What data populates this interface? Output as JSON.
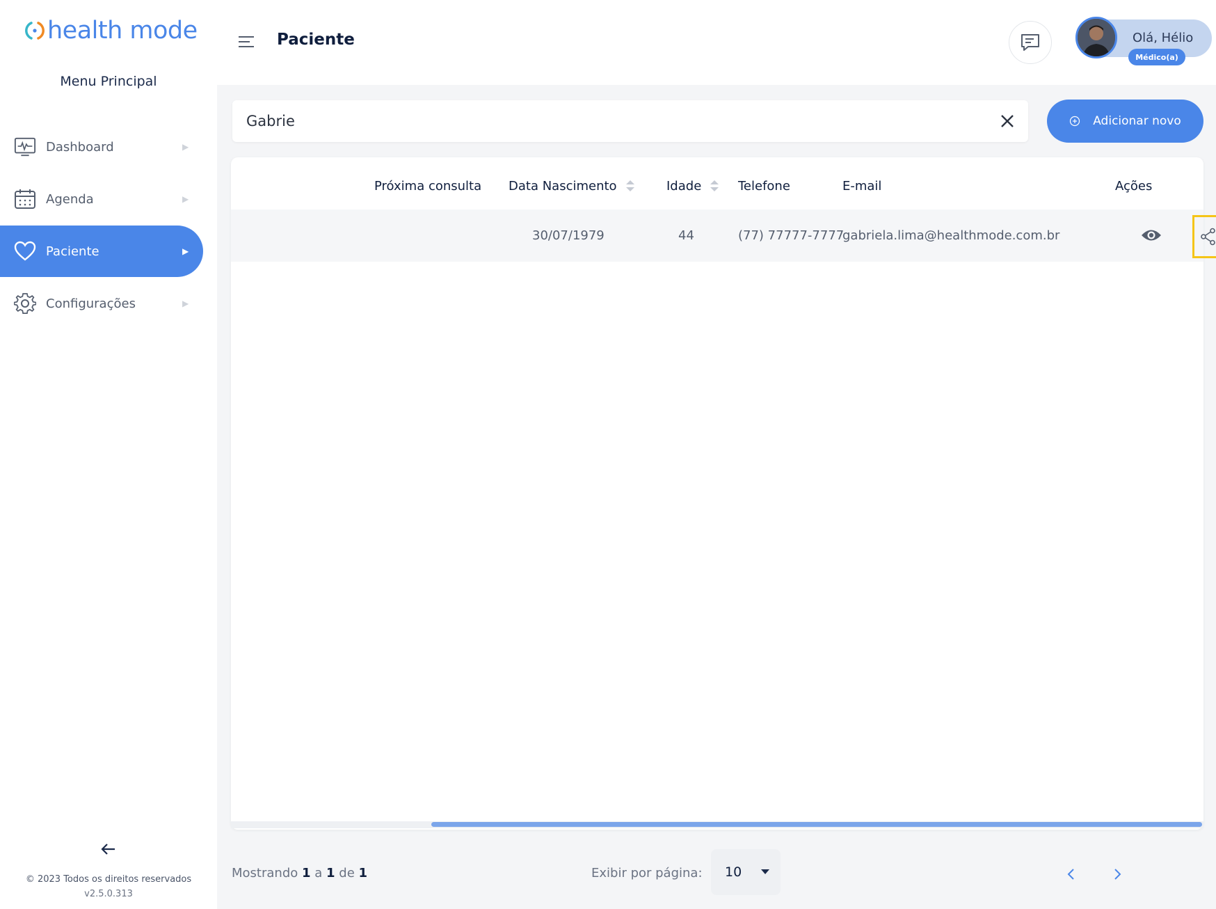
{
  "app": {
    "logo_text": "health mode",
    "brand_color": "#4a86e8"
  },
  "sidebar": {
    "menu_title": "Menu Principal",
    "items": [
      {
        "label": "Dashboard",
        "icon": "monitor-pulse-icon",
        "active": false
      },
      {
        "label": "Agenda",
        "icon": "calendar-icon",
        "active": false
      },
      {
        "label": "Paciente",
        "icon": "heart-icon",
        "active": true
      },
      {
        "label": "Configurações",
        "icon": "gear-icon",
        "active": false
      }
    ],
    "collapse_icon": "arrow-left-icon",
    "copyright": "© 2023 Todos os direitos reservados",
    "version": "v2.5.0.313"
  },
  "header": {
    "page_title": "Paciente",
    "greeting": "Olá, Hélio",
    "role": "Médico(a)"
  },
  "search": {
    "value": "Gabrie",
    "add_button_label": "Adicionar novo"
  },
  "table": {
    "columns": [
      "Próxima consulta",
      "Data Nascimento",
      "Idade",
      "Telefone",
      "E-mail",
      "Ações"
    ],
    "rows": [
      {
        "proxima_consulta": "",
        "data_nascimento": "30/07/1979",
        "idade": "44",
        "telefone": "(77) 77777-7777",
        "email": "gabriela.lima@healthmode.com.br"
      }
    ]
  },
  "pagination": {
    "showing_prefix": "Mostrando",
    "from": "1",
    "sep1": "a",
    "to": "1",
    "sep2": "de",
    "total": "1",
    "per_page_label": "Exibir por página:",
    "per_page_value": "10"
  }
}
